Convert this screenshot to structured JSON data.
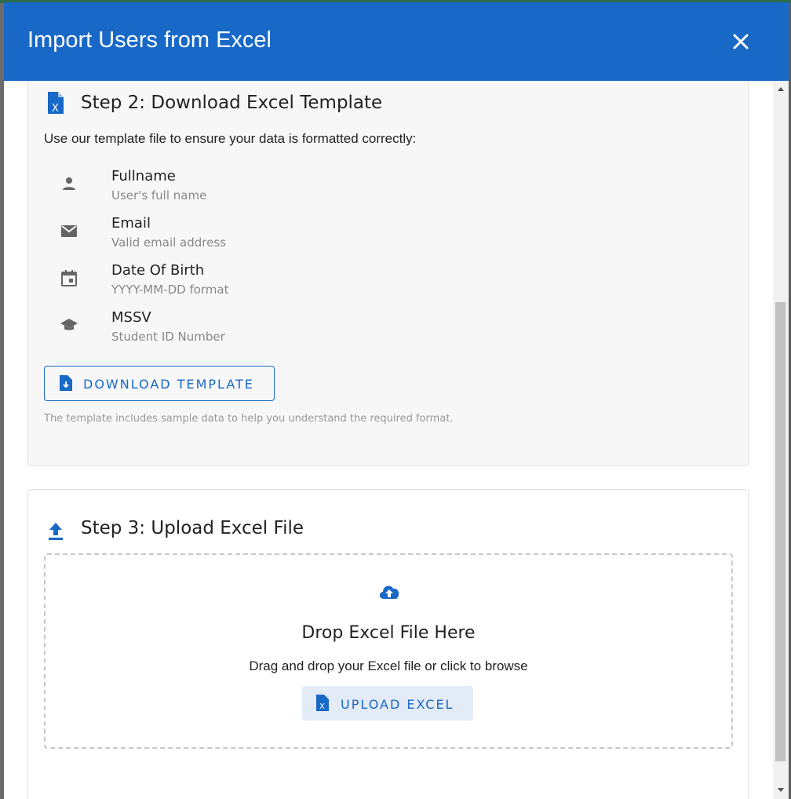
{
  "modal": {
    "title": "Import Users from Excel",
    "close_icon": "close-icon"
  },
  "step2": {
    "title": "Step 2: Download Excel Template",
    "icon": "excel-file-icon",
    "intro": "Use our template file to ensure your data is formatted correctly:",
    "fields": [
      {
        "name": "Fullname",
        "description": "User's full name",
        "icon": "person-icon"
      },
      {
        "name": "Email",
        "description": "Valid email address",
        "icon": "email-icon"
      },
      {
        "name": "Date Of Birth",
        "description": "YYYY-MM-DD format",
        "icon": "calendar-icon"
      },
      {
        "name": "MSSV",
        "description": "Student ID Number",
        "icon": "graduation-cap-icon"
      }
    ],
    "download_button": "DOWNLOAD TEMPLATE",
    "note": "The template includes sample data to help you understand the required format."
  },
  "step3": {
    "title": "Step 3: Upload Excel File",
    "icon": "upload-icon",
    "drop_title": "Drop Excel File Here",
    "drop_subtitle": "Drag and drop your Excel file or click to browse",
    "upload_button": "UPLOAD EXCEL"
  },
  "colors": {
    "primary": "#1868c7",
    "header_bg": "#1868c7",
    "card_bg": "#f7f7f7",
    "upload_btn_bg": "#e3ebf6"
  }
}
